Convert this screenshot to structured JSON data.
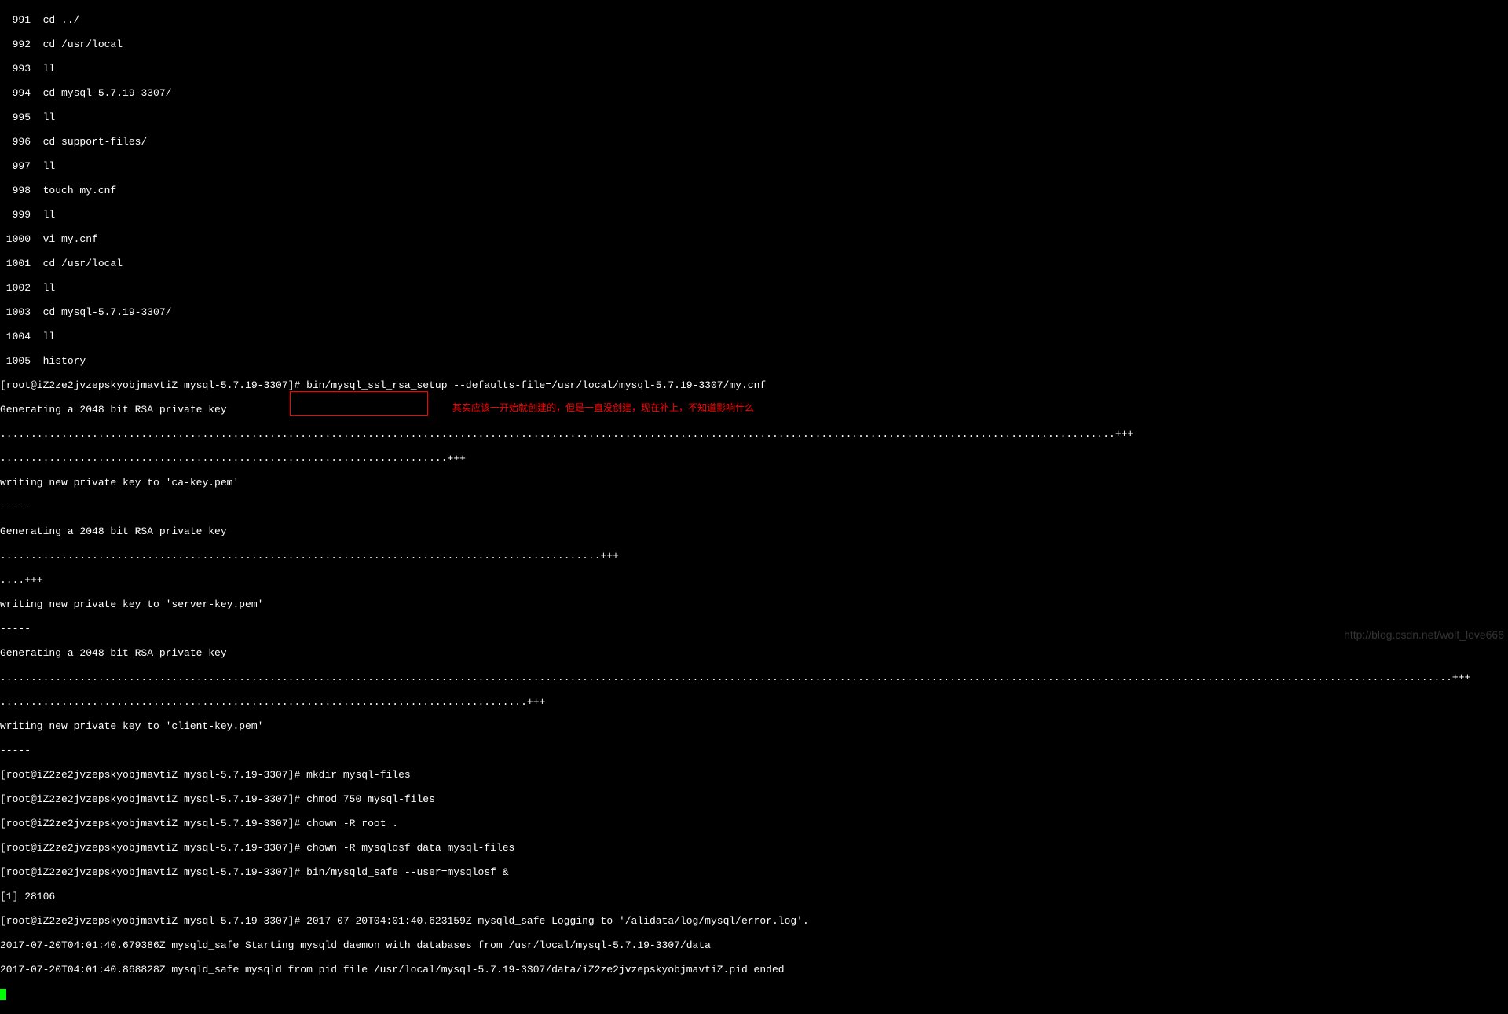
{
  "history": [
    {
      "num": "  991",
      "cmd": "  cd ../"
    },
    {
      "num": "  992",
      "cmd": "  cd /usr/local"
    },
    {
      "num": "  993",
      "cmd": "  ll"
    },
    {
      "num": "  994",
      "cmd": "  cd mysql-5.7.19-3307/"
    },
    {
      "num": "  995",
      "cmd": "  ll"
    },
    {
      "num": "  996",
      "cmd": "  cd support-files/"
    },
    {
      "num": "  997",
      "cmd": "  ll"
    },
    {
      "num": "  998",
      "cmd": "  touch my.cnf"
    },
    {
      "num": "  999",
      "cmd": "  ll"
    },
    {
      "num": " 1000",
      "cmd": "  vi my.cnf"
    },
    {
      "num": " 1001",
      "cmd": "  cd /usr/local"
    },
    {
      "num": " 1002",
      "cmd": "  ll"
    },
    {
      "num": " 1003",
      "cmd": "  cd mysql-5.7.19-3307/"
    },
    {
      "num": " 1004",
      "cmd": "  ll"
    },
    {
      "num": " 1005",
      "cmd": "  history"
    }
  ],
  "prompt": "[root@iZ2ze2jvzepskyobjmavtiZ mysql-5.7.19-3307]# ",
  "lines": {
    "ssl_setup": "bin/mysql_ssl_rsa_setup --defaults-file=/usr/local/mysql-5.7.19-3307/my.cnf",
    "gen1": "Generating a 2048 bit RSA private key",
    "dots1": "......................................................................................................................................................................................+++",
    "dots2": ".........................................................................+++",
    "writing1": "writing new private key to 'ca-key.pem'",
    "dashes": "-----",
    "gen2": "Generating a 2048 bit RSA private key",
    "dots3": "..................................................................................................+++",
    "dots4": "....+++",
    "writing2": "writing new private key to 'server-key.pem'",
    "gen3": "Generating a 2048 bit RSA private key",
    "dots5": ".............................................................................................................................................................................................................................................+++",
    "dots6": "......................................................................................+++",
    "writing3": "writing new private key to 'client-key.pem'",
    "mkdir": "mkdir mysql-files",
    "chmod": "chmod 750 mysql-files",
    "chown1": "chown -R root .",
    "chown2": "chown -R mysqlosf data mysql-files",
    "safe": "bin/mysqld_safe --user=mysqlosf &",
    "job": "[1] 28106",
    "log1": "2017-07-20T04:01:40.623159Z mysqld_safe Logging to '/alidata/log/mysql/error.log'.",
    "log2": "2017-07-20T04:01:40.679386Z mysqld_safe Starting mysqld daemon with databases from /usr/local/mysql-5.7.19-3307/data",
    "log3": "2017-07-20T04:01:40.868828Z mysqld_safe mysqld from pid file /usr/local/mysql-5.7.19-3307/data/iZ2ze2jvzepskyobjmavtiZ.pid ended"
  },
  "annotation": "其实应该一开始就创建的，但是一直没创建，现在补上，不知道影响什么",
  "watermark": "http://blog.csdn.net/wolf_love666"
}
